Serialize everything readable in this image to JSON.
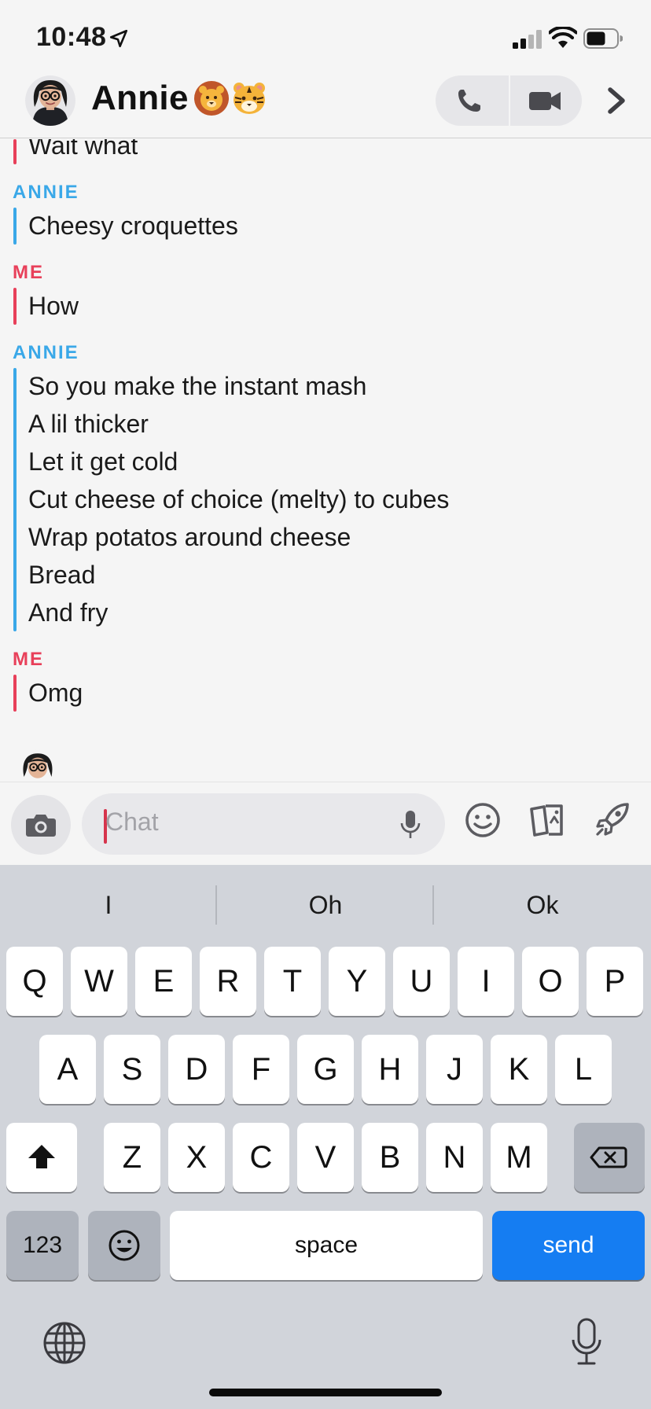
{
  "status_bar": {
    "time": "10:48",
    "icons": [
      "location-arrow-icon",
      "signal-icon",
      "wifi-icon",
      "battery-icon"
    ]
  },
  "header": {
    "contact_name": "Annie",
    "name_emojis": [
      "lion-face-emoji",
      "tiger-face-emoji"
    ],
    "actions": [
      "phone-icon",
      "video-icon",
      "chevron-right-icon"
    ]
  },
  "messages": [
    {
      "sender": "",
      "side": "me",
      "lines": [
        "Wait what"
      ]
    },
    {
      "sender": "ANNIE",
      "side": "annie",
      "lines": [
        "Cheesy croquettes"
      ]
    },
    {
      "sender": "ME",
      "side": "me",
      "lines": [
        "How"
      ]
    },
    {
      "sender": "ANNIE",
      "side": "annie",
      "lines": [
        "So you make the instant mash",
        "A lil thicker",
        "Let it get cold",
        "Cut cheese of choice (melty) to cubes",
        "Wrap potatos around cheese",
        "Bread",
        "And fry"
      ]
    },
    {
      "sender": "ME",
      "side": "me",
      "lines": [
        "Omg"
      ]
    }
  ],
  "composer": {
    "placeholder": "Chat",
    "icons": [
      "camera-icon",
      "microphone-icon",
      "smiley-icon",
      "cards-icon",
      "rocket-icon"
    ]
  },
  "keyboard": {
    "suggestions": [
      "I",
      "Oh",
      "Ok"
    ],
    "row1": [
      "Q",
      "W",
      "E",
      "R",
      "T",
      "Y",
      "U",
      "I",
      "O",
      "P"
    ],
    "row2": [
      "A",
      "S",
      "D",
      "F",
      "G",
      "H",
      "J",
      "K",
      "L"
    ],
    "row3": [
      "Z",
      "X",
      "C",
      "V",
      "B",
      "N",
      "M"
    ],
    "numbers_label": "123",
    "space_label": "space",
    "send_label": "send"
  },
  "colors": {
    "annie": "#3aa8e8",
    "me": "#e8405a",
    "send_key": "#157df2"
  }
}
